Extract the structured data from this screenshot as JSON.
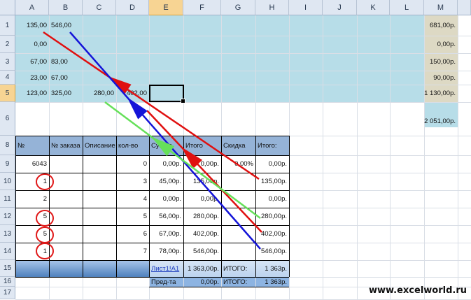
{
  "columns": [
    "A",
    "B",
    "C",
    "D",
    "E",
    "F",
    "G",
    "H",
    "I",
    "J",
    "K",
    "L",
    "M"
  ],
  "rows": [
    "1",
    "2",
    "3",
    "4",
    "5",
    "6",
    "8",
    "9",
    "10",
    "11",
    "12",
    "13",
    "14",
    "15",
    "16",
    "17"
  ],
  "selected_column": "E",
  "selected_row": "5",
  "top_block": {
    "a": [
      "135,00",
      "0,00",
      "67,00",
      "23,00",
      "123,00"
    ],
    "b": [
      "546,00",
      "",
      "83,00",
      "67,00",
      "325,00"
    ],
    "c5": "280,00",
    "d5": "402,00",
    "m": [
      "681,00р.",
      "0,00р.",
      "150,00р.",
      "90,00р.",
      "1 130,00р.",
      "2 051,00р."
    ]
  },
  "table": {
    "headers": [
      "№",
      "№ заказа",
      "Описание",
      "кол-во",
      "Сумма",
      "Итого",
      "Скидка",
      "Итого:"
    ],
    "rows": [
      {
        "a": "6043",
        "b": "",
        "d": "0",
        "e": "0,00р.",
        "f": "0,00р.",
        "g": "0,00%",
        "h": "0,00р."
      },
      {
        "a": "1",
        "b": "",
        "d": "3",
        "e": "45,00р.",
        "f": "135,00р.",
        "g": "",
        "h": "135,00р."
      },
      {
        "a": "2",
        "b": "",
        "d": "4",
        "e": "0,00р.",
        "f": "0,00р.",
        "g": "",
        "h": "0,00р."
      },
      {
        "a": "5",
        "b": "",
        "d": "5",
        "e": "56,00р.",
        "f": "280,00р.",
        "g": "",
        "h": "280,00р."
      },
      {
        "a": "5",
        "b": "",
        "d": "6",
        "e": "67,00р.",
        "f": "402,00р.",
        "g": "",
        "h": "402,00р."
      },
      {
        "a": "1",
        "b": "",
        "d": "7",
        "e": "78,00р.",
        "f": "546,00р.",
        "g": "",
        "h": "546,00р."
      }
    ],
    "row15": {
      "e": "Лист1!A1",
      "f": "1 363,00р.",
      "g": "ИТОГО:",
      "h": "1 363р."
    },
    "row16": {
      "e": "Пред-та",
      "f": "0,00р.",
      "g": "ИТОГО:",
      "h": "1 363р."
    }
  },
  "colors": {
    "top_fill": "#b7dde8",
    "m_fill": "#ddd9c4",
    "header_fill": "#95b3d7",
    "footer_fill": "#8db4e2",
    "footer_dark": "#4f81bd",
    "arrow_red": "#e01010",
    "arrow_blue": "#1414d8",
    "arrow_green": "#66e05a",
    "circle": "#e01818"
  },
  "watermark": "www.excelworld.ru"
}
